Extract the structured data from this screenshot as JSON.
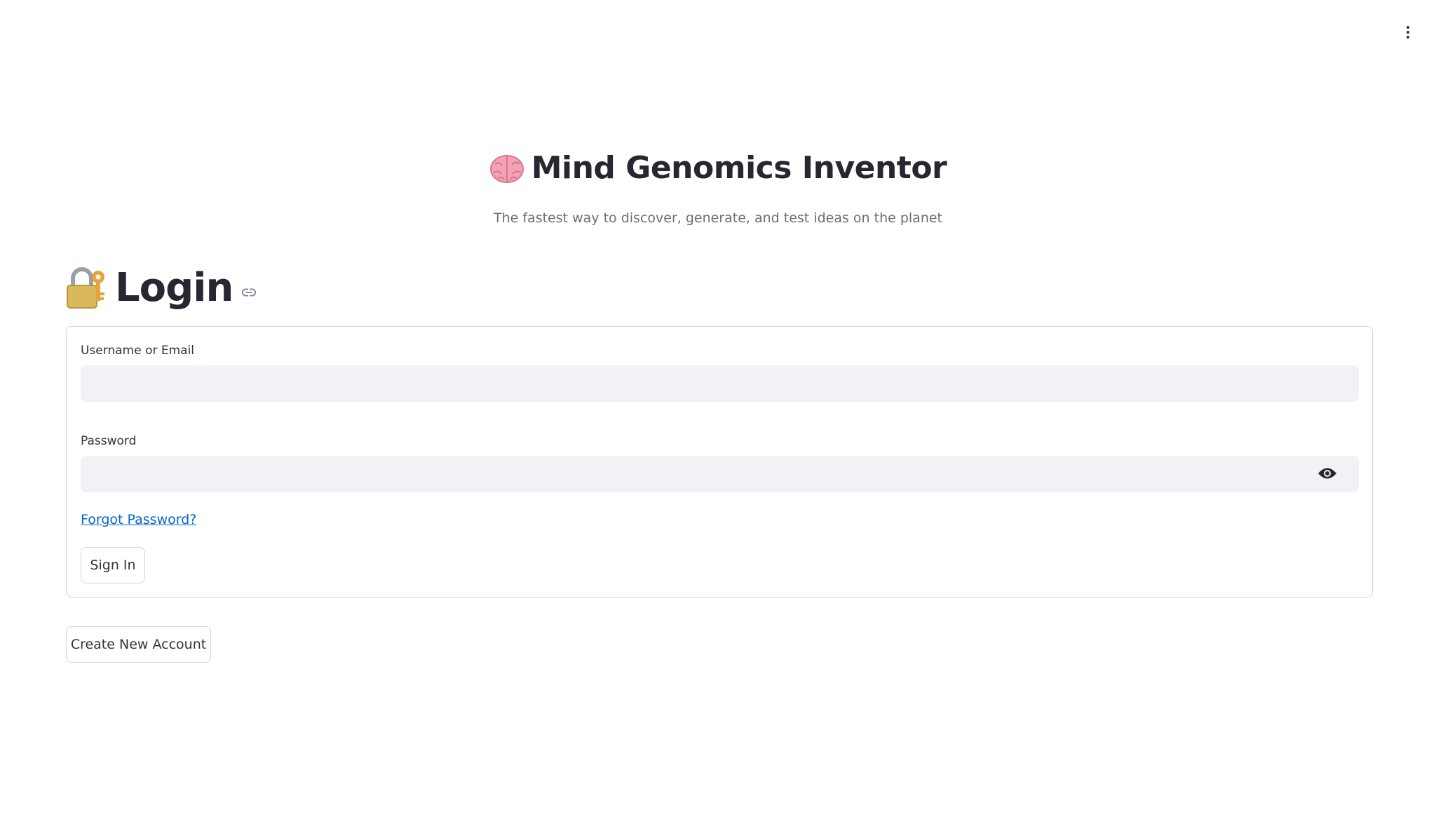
{
  "header": {
    "title": "Mind Genomics Inventor",
    "title_icon": "brain-icon",
    "tagline": "The fastest way to discover, generate, and test ideas on the planet"
  },
  "login": {
    "title": "Login",
    "title_icon": "lock-with-key-icon",
    "anchor_icon": "link-icon"
  },
  "form": {
    "username_label": "Username or Email",
    "username_value": "",
    "password_label": "Password",
    "password_value": "",
    "password_toggle_icon": "eye-icon",
    "forgot_password": "Forgot Password?",
    "sign_in": "Sign In"
  },
  "create_account": "Create New Account",
  "menu_icon": "kebab-menu-icon",
  "colors": {
    "link": "#0068c9",
    "input_bg": "#f0f2f6",
    "border": "#d6d6d9",
    "text": "#31333f"
  }
}
